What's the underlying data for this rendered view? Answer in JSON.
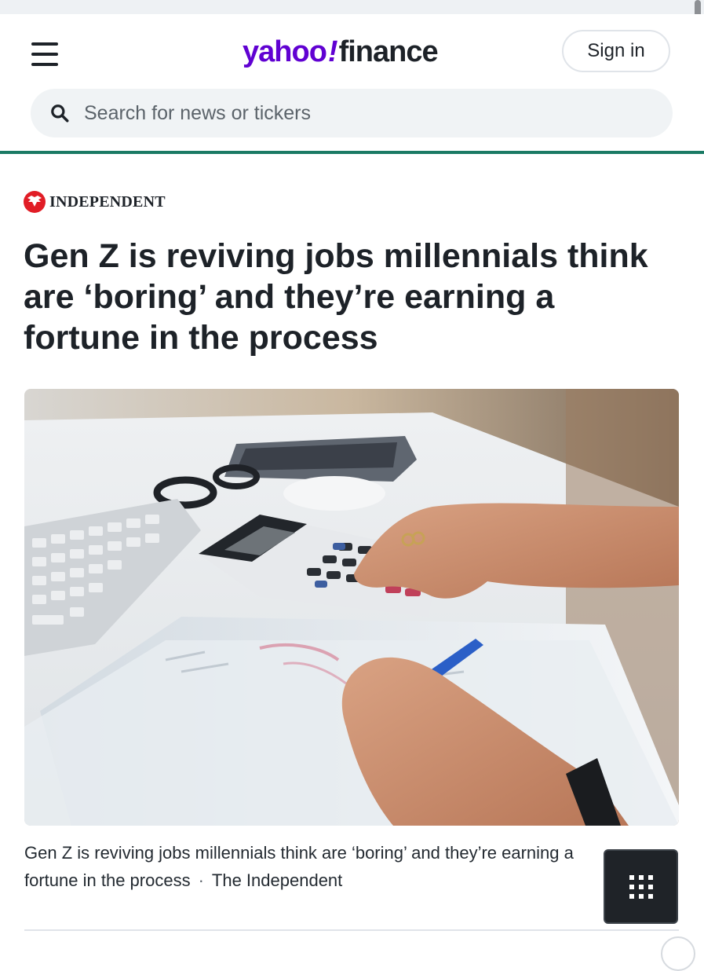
{
  "header": {
    "logo": {
      "brand": "yahoo",
      "bang": "!",
      "product": "finance"
    },
    "sign_in_label": "Sign in",
    "search": {
      "placeholder": "Search for news or tickers"
    }
  },
  "article": {
    "source": "INDEPENDENT",
    "headline": "Gen Z is reviving jobs millennials think are ‘boring’ and they’re earning a fortune in the process",
    "image_caption": "Gen Z is reviving jobs millennials think are ‘boring’ and they’re earning a fortune in the process",
    "caption_source": "The Independent",
    "caption_separator": "·"
  },
  "colors": {
    "brand_purple": "#6001d2",
    "accent_line": "#1a7a64",
    "independent_red": "#e11d26",
    "text": "#1d2228"
  },
  "icons": [
    "hamburger-menu-icon",
    "search-icon",
    "independent-eagle-icon",
    "grid-dots-icon"
  ]
}
